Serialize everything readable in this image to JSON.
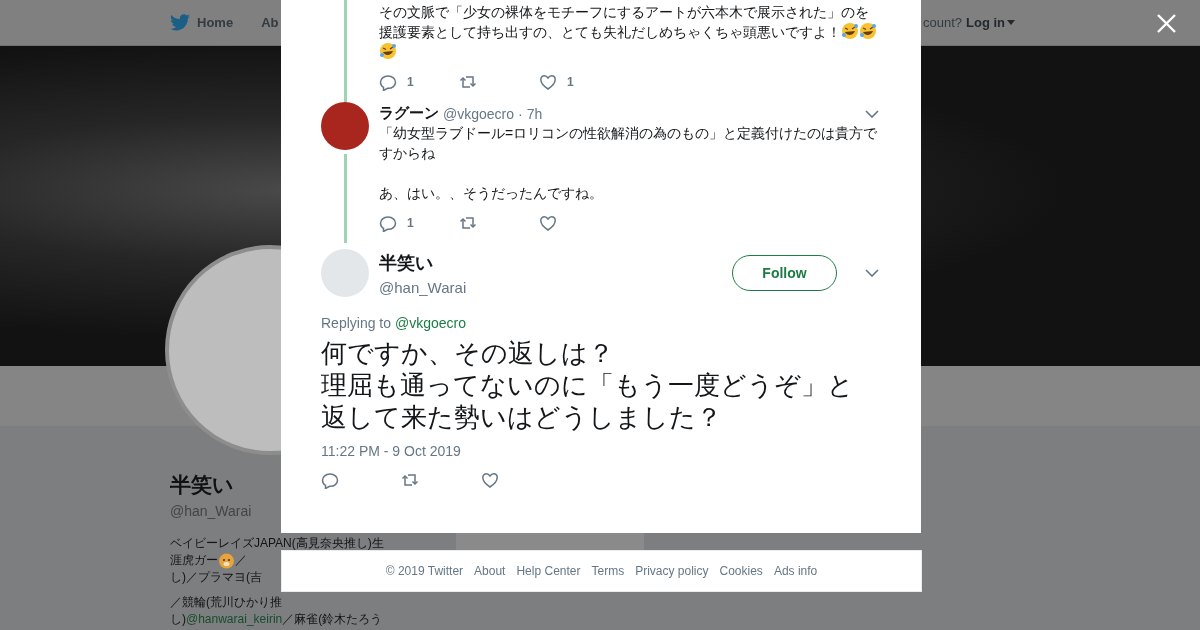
{
  "nav": {
    "items": [
      {
        "kind": "home",
        "label": "Home"
      },
      {
        "kind": "plain",
        "label": "Ab"
      }
    ],
    "account_prompt": "count?",
    "login": "Log in"
  },
  "profile": {
    "name": "半笑い",
    "handle": "@han_Warai",
    "bio_lines": [
      [
        {
          "kind": "text",
          "text": "ベイビーレイズJAPAN(高見奈央推し)生"
        }
      ],
      [
        {
          "kind": "text",
          "text": "涯虎ガー"
        },
        {
          "kind": "emoji"
        },
        {
          "kind": "text",
          "text": "／"
        }
      ],
      [
        {
          "kind": "text",
          "text": "し)／プラマヨ(吉"
        }
      ],
      [
        {
          "kind": "text",
          "text": "／競輪(荒川ひかり推"
        }
      ],
      [
        {
          "kind": "text",
          "text": "し)"
        },
        {
          "kind": "link",
          "text": "@hanwarai_keirin"
        },
        {
          "kind": "text",
          "text": "／麻雀(鈴木たろう"
        }
      ]
    ]
  },
  "thread": [
    {
      "paragraphs": [
        "その文脈で「少女の裸体をモチーフにするアートが六本木で展示された」のを援護要素として持ち出すの、とても失礼だしめちゃくちゃ頭悪いですよ！"
      ],
      "emoji": [
        {
          "kind": "rofl"
        },
        {
          "kind": "rofl"
        },
        {
          "kind": "rofl"
        }
      ],
      "actions": [
        {
          "kind": "reply",
          "count": "1"
        },
        {
          "kind": "retweet"
        },
        {
          "kind": "like",
          "count": "1"
        }
      ]
    },
    {
      "name": "ラグーン",
      "handle": "@vkgoecro",
      "dot": "·",
      "time": "7h",
      "paragraphs": [
        "「幼女型ラブドール=ロリコンの性欲解消の為のもの」と定義付けたのは貴方ですからね",
        "あ、はい。、そうだったんですね。"
      ],
      "actions": [
        {
          "kind": "reply",
          "count": "1"
        },
        {
          "kind": "retweet"
        },
        {
          "kind": "like"
        }
      ]
    }
  ],
  "focused": {
    "name": "半笑い",
    "handle": "@han_Warai",
    "follow": "Follow",
    "replying_label": "Replying to",
    "replying_to": "@vkgoecro",
    "lines": [
      "何ですか、その返しは？",
      "理屈も通ってないのに「もう一度どうぞ」と",
      "返して来た勢いはどうしました？"
    ],
    "timestamp": "11:22 PM - 9 Oct 2019",
    "actions": [
      {
        "kind": "reply"
      },
      {
        "kind": "retweet"
      },
      {
        "kind": "like"
      }
    ]
  },
  "footer": {
    "links": [
      "© 2019 Twitter",
      "About",
      "Help Center",
      "Terms",
      "Privacy policy",
      "Cookies",
      "Ads info"
    ]
  }
}
